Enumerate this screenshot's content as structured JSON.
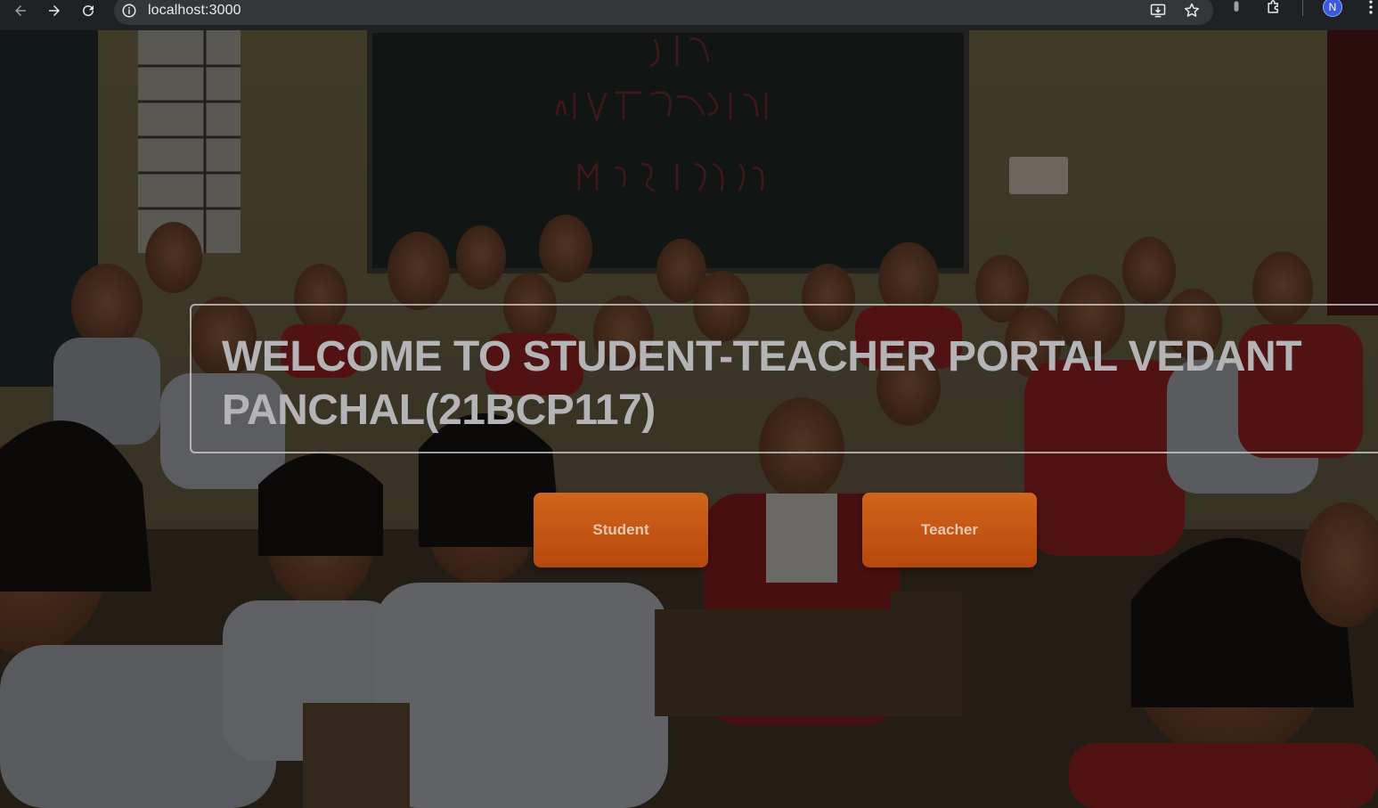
{
  "browser": {
    "url": "localhost:3000",
    "profile_initial": "N",
    "icons": {
      "back": "arrow-left-icon",
      "forward": "arrow-right-icon",
      "reload": "reload-icon",
      "site_info": "info-icon",
      "install": "install-app-icon",
      "bookmark": "star-icon",
      "extension": "puzzle-icon",
      "menu": "kebab-menu-icon"
    }
  },
  "hero": {
    "title": "WELCOME TO STUDENT-TEACHER PORTAL VEDANT PANCHAL(21BCP117)",
    "buttons": {
      "student_label": "Student",
      "teacher_label": "Teacher"
    },
    "colors": {
      "button_orange": "#c55a14",
      "title_text": "#b4b4b6",
      "chrome_bg": "#202124"
    }
  }
}
